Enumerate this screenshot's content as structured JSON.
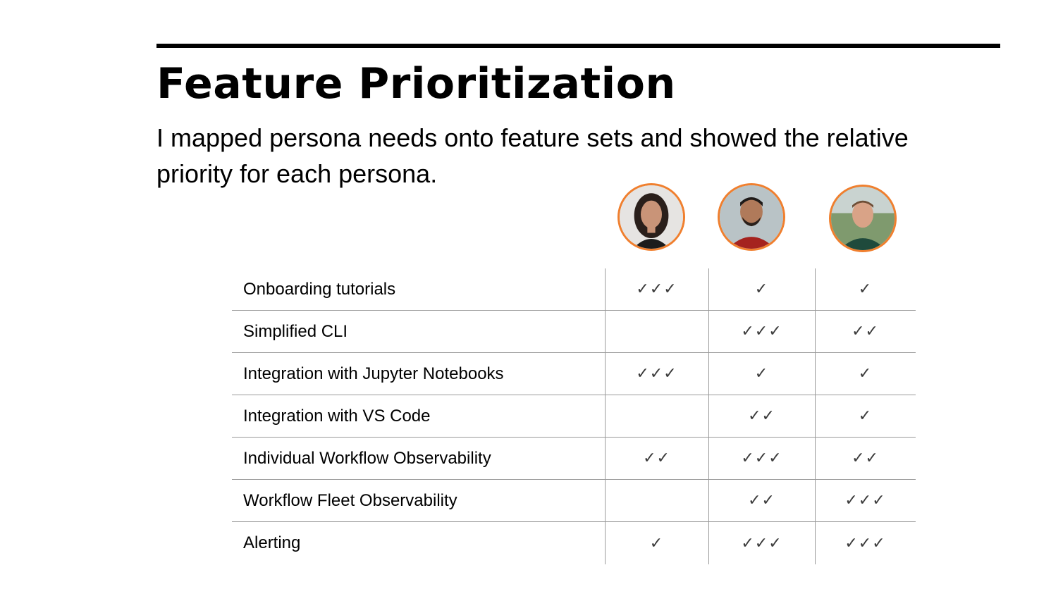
{
  "slide": {
    "title": "Feature Prioritization",
    "subtitle": "I mapped persona needs onto feature sets and showed the relative priority for each persona."
  },
  "personas": [
    {
      "icon": "persona-1-avatar",
      "accent": "#f07f2e"
    },
    {
      "icon": "persona-2-avatar",
      "accent": "#f07f2e"
    },
    {
      "icon": "persona-3-avatar",
      "accent": "#f07f2e"
    }
  ],
  "rows": [
    {
      "feature": "Onboarding tutorials",
      "p1": "✓✓✓",
      "p2": "✓",
      "p3": "✓"
    },
    {
      "feature": "Simplified CLI",
      "p1": "",
      "p2": "✓✓✓",
      "p3": "✓✓"
    },
    {
      "feature": "Integration with Jupyter Notebooks",
      "p1": "✓✓✓",
      "p2": "✓",
      "p3": "✓"
    },
    {
      "feature": "Integration with VS Code",
      "p1": "",
      "p2": "✓✓",
      "p3": "✓"
    },
    {
      "feature": "Individual Workflow Observability",
      "p1": "✓✓",
      "p2": "✓✓✓",
      "p3": "✓✓"
    },
    {
      "feature": "Workflow Fleet Observability",
      "p1": "",
      "p2": "✓✓",
      "p3": "✓✓✓"
    },
    {
      "feature": "Alerting",
      "p1": "✓",
      "p2": "✓✓✓",
      "p3": "✓✓✓"
    }
  ]
}
